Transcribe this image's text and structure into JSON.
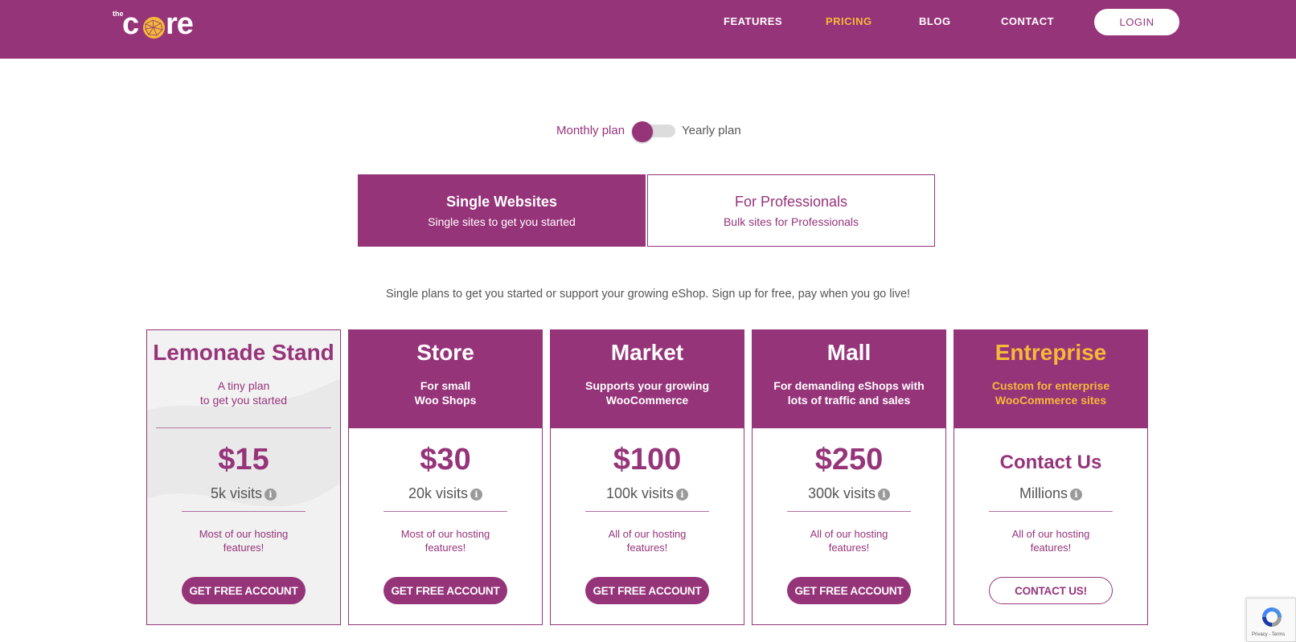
{
  "header": {
    "logo": {
      "the": "the",
      "brand_c": "c",
      "brand_re": "re"
    },
    "nav": [
      {
        "label": "FEATURES"
      },
      {
        "label": "PRICING",
        "active": true
      },
      {
        "label": "BLOG"
      },
      {
        "label": "CONTACT"
      }
    ],
    "login_label": "LOGIN"
  },
  "billing_toggle": {
    "monthly_label": "Monthly plan",
    "yearly_label": "Yearly plan",
    "selected": "monthly"
  },
  "tabs": [
    {
      "title": "Single Websites",
      "subtitle": "Single sites to get you started",
      "active": true
    },
    {
      "title": "For Professionals",
      "subtitle": "Bulk sites for Professionals",
      "active": false
    }
  ],
  "intro": "Single plans to get you started or support your growing eShop. Sign up for free, pay when you go live!",
  "plans": [
    {
      "name": "Lemonade Stand",
      "desc_line1": "A tiny plan",
      "desc_line2": "to get you started",
      "price": "$15",
      "visits": "5k visits",
      "features": "Most of our hosting features!",
      "cta": "GET FREE ACCOUNT"
    },
    {
      "name": "Store",
      "desc_line1": "For small",
      "desc_line2": "Woo Shops",
      "price": "$30",
      "visits": "20k visits",
      "features": "Most of our hosting features!",
      "cta": "GET FREE ACCOUNT"
    },
    {
      "name": "Market",
      "desc_line1": "Supports your growing",
      "desc_line2": "WooCommerce",
      "price": "$100",
      "visits": "100k visits",
      "features": "All of our hosting features!",
      "cta": "GET FREE ACCOUNT"
    },
    {
      "name": "Mall",
      "desc_line1": "For demanding eShops with",
      "desc_line2": "lots of traffic and sales",
      "price": "$250",
      "visits": "300k visits",
      "features": "All of our hosting features!",
      "cta": "GET FREE ACCOUNT"
    },
    {
      "name": "Entreprise",
      "desc_line1": "Custom for enterprise",
      "desc_line2": "WooCommerce sites",
      "price": "Contact Us",
      "visits": "Millions",
      "features": "All of our hosting features!",
      "cta": "CONTACT US!"
    }
  ],
  "info_icon_glyph": "i",
  "recaptcha": {
    "links": "Privacy - Terms"
  },
  "colors": {
    "brand": "#96347a",
    "accent": "#f5b938"
  }
}
